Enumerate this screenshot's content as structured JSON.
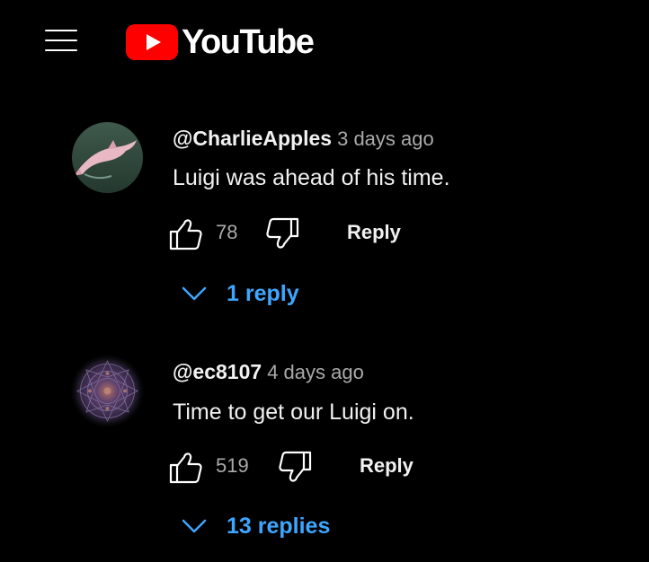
{
  "header": {
    "logo_text": "YouTube",
    "brand_color": "#FF0000"
  },
  "comments": [
    {
      "author": "@CharlieApples",
      "time": "3 days ago",
      "text": "Luigi was ahead of his time.",
      "likes": "78",
      "reply_label": "Reply",
      "replies_label": "1 reply",
      "avatar": "pink-dolphin-photo"
    },
    {
      "author": "@ec8107",
      "time": "4 days ago",
      "text": "Time to get our Luigi on.",
      "likes": "519",
      "reply_label": "Reply",
      "replies_label": "13 replies",
      "avatar": "purple-mandala"
    }
  ],
  "colors": {
    "background": "#000000",
    "text": "#f1f1f1",
    "secondary_text": "#aaaaaa",
    "link_blue": "#3ea6ff"
  }
}
